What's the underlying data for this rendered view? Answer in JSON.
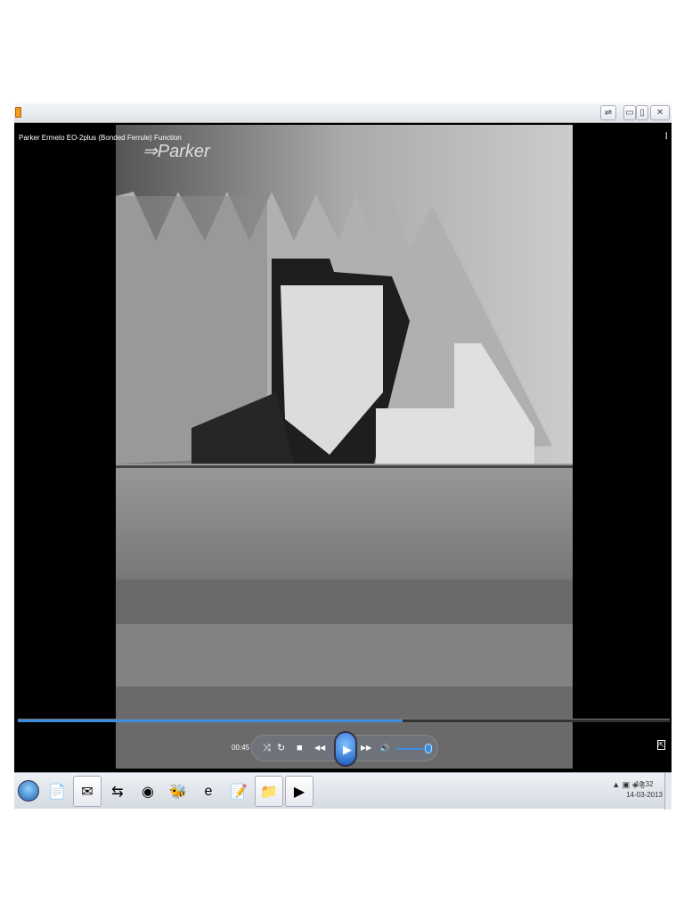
{
  "window": {
    "title_bar_buttons": {
      "restore": "⇌",
      "minimize": "▭",
      "maximize": "▯",
      "close": "✕"
    }
  },
  "video": {
    "title": "Parker Ermeto EO-2plus (Bonded Ferrule) Function",
    "watermark": "Parker",
    "progress": 0.59
  },
  "controls": {
    "time": "00:45",
    "shuffle": "⤨",
    "repeat": "↻",
    "stop": "■",
    "prev": "◀◀",
    "play": "▶",
    "next": "▶▶",
    "mute": "🔊",
    "volume": 1.0,
    "fullscreen": "⇱",
    "layout": "⁞"
  },
  "taskbar": {
    "items": [
      {
        "name": "notepad-doc",
        "glyph": "📄"
      },
      {
        "name": "outlook",
        "glyph": "✉"
      },
      {
        "name": "teamviewer",
        "glyph": "⇆"
      },
      {
        "name": "chrome",
        "glyph": "◉"
      },
      {
        "name": "bee-app",
        "glyph": "🐝"
      },
      {
        "name": "internet-explorer",
        "glyph": "e"
      },
      {
        "name": "notepad",
        "glyph": "📝"
      },
      {
        "name": "explorer",
        "glyph": "📁"
      },
      {
        "name": "media-player",
        "glyph": "▶"
      }
    ],
    "tray": "▲ ▣ ◈ ▯",
    "time": "10:32",
    "date": "14-03-2013"
  }
}
